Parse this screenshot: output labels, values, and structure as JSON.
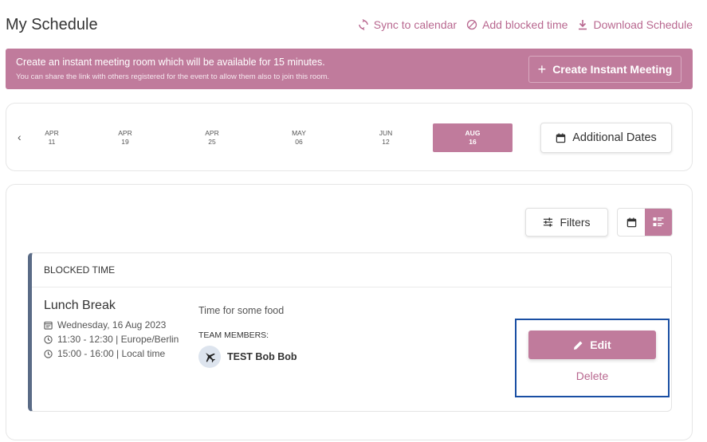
{
  "header": {
    "title": "My Schedule",
    "actions": [
      {
        "label": "Sync to calendar",
        "icon": "sync-icon"
      },
      {
        "label": "Add blocked time",
        "icon": "block-icon"
      },
      {
        "label": "Download Schedule",
        "icon": "download-icon"
      }
    ]
  },
  "instant_meeting": {
    "line1": "Create an instant meeting room which will be available for 15 minutes.",
    "line2": "You can share the link with others registered for the event to allow them also to join this room.",
    "button_label": "Create Instant Meeting",
    "button_icon": "plus-icon"
  },
  "dates": {
    "prev_icon": "chevron-left-icon",
    "items": [
      {
        "month": "APR",
        "day": "11"
      },
      {
        "month": "APR",
        "day": "19"
      },
      {
        "month": "APR",
        "day": "25"
      },
      {
        "month": "MAY",
        "day": "06"
      },
      {
        "month": "JUN",
        "day": "12"
      },
      {
        "month": "AUG",
        "day": "16",
        "selected": true
      }
    ],
    "additional_label": "Additional Dates",
    "additional_icon": "calendar-icon"
  },
  "toolbar": {
    "filters_label": "Filters",
    "filters_icon": "sliders-icon",
    "views": [
      {
        "icon": "calendar-icon",
        "active": false
      },
      {
        "icon": "list-icon",
        "active": true
      }
    ]
  },
  "event": {
    "type": "BLOCKED TIME",
    "title": "Lunch Break",
    "date": "Wednesday, 16 Aug 2023",
    "time_event": "11:30 - 12:30 | Europe/Berlin",
    "time_local": "15:00 - 16:00 | Local time",
    "description": "Time for some food",
    "team_label": "TEAM MEMBERS:",
    "members": [
      {
        "name": "TEST Bob Bob"
      }
    ],
    "edit_label": "Edit",
    "delete_label": "Delete"
  },
  "colors": {
    "accent": "#c07b9c",
    "accent_text": "#b8678f",
    "event_border": "#5a6b86",
    "focus_outline": "#1a4fa3"
  }
}
